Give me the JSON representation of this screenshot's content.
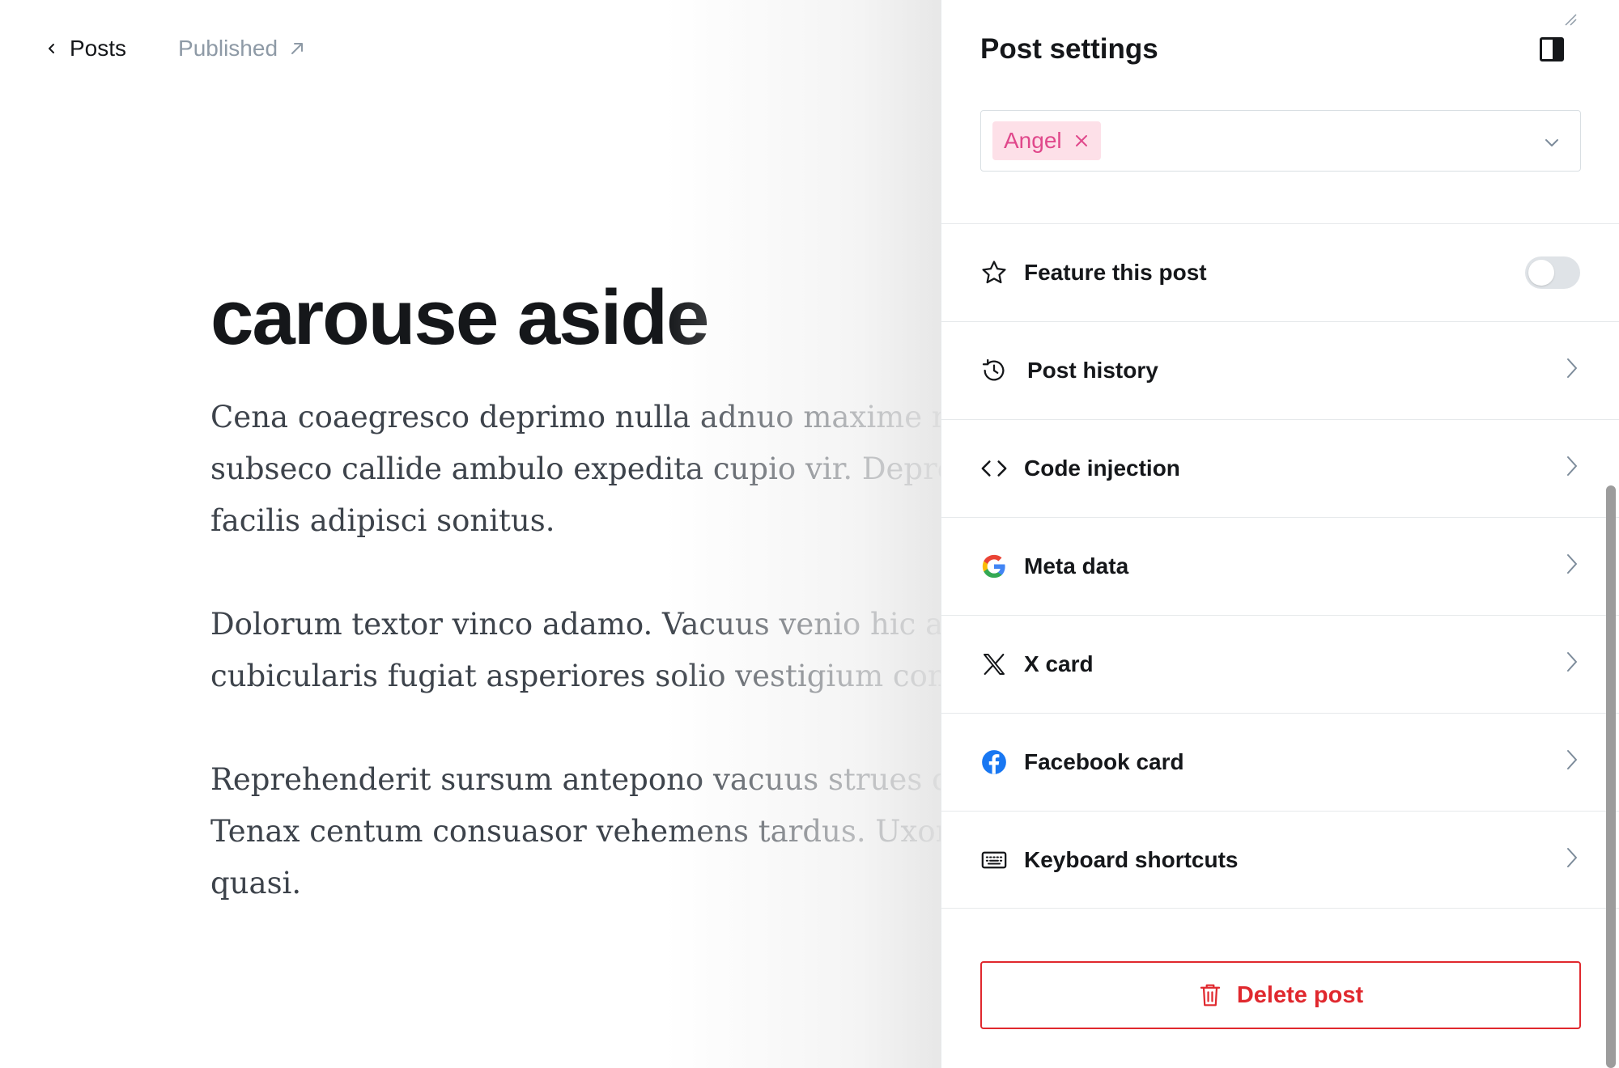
{
  "topnav": {
    "back_label": "Posts",
    "status_label": "Published"
  },
  "post": {
    "title": "carouse aside",
    "paragraphs": [
      "Cena coaegresco deprimo nulla adnuo maxime nat\nsubseco callide ambulo expedita cupio vir. Depron\nfacilis adipisci sonitus.",
      "Dolorum textor vinco adamo. Vacuus venio hic apt\ncubicularis fugiat asperiores solio vestigium contra",
      "Reprehenderit sursum antepono vacuus strues qui\nTenax centum consuasor vehemens tardus. Uxor v\nquasi."
    ]
  },
  "settings": {
    "title": "Post settings",
    "author_tag": "Angel",
    "feature_label": "Feature this post",
    "feature_enabled": false,
    "rows": [
      {
        "label": "Post history",
        "icon": "history-icon"
      },
      {
        "label": "Code injection",
        "icon": "code-icon"
      },
      {
        "label": "Meta data",
        "icon": "google-icon"
      },
      {
        "label": "X card",
        "icon": "x-logo-icon"
      },
      {
        "label": "Facebook card",
        "icon": "facebook-icon"
      },
      {
        "label": "Keyboard shortcuts",
        "icon": "keyboard-icon"
      }
    ],
    "delete_label": "Delete post"
  },
  "colors": {
    "accent_tag_bg": "#fde0e8",
    "accent_tag_text": "#e0488b",
    "danger": "#e0282e",
    "facebook_blue": "#1877f2"
  }
}
